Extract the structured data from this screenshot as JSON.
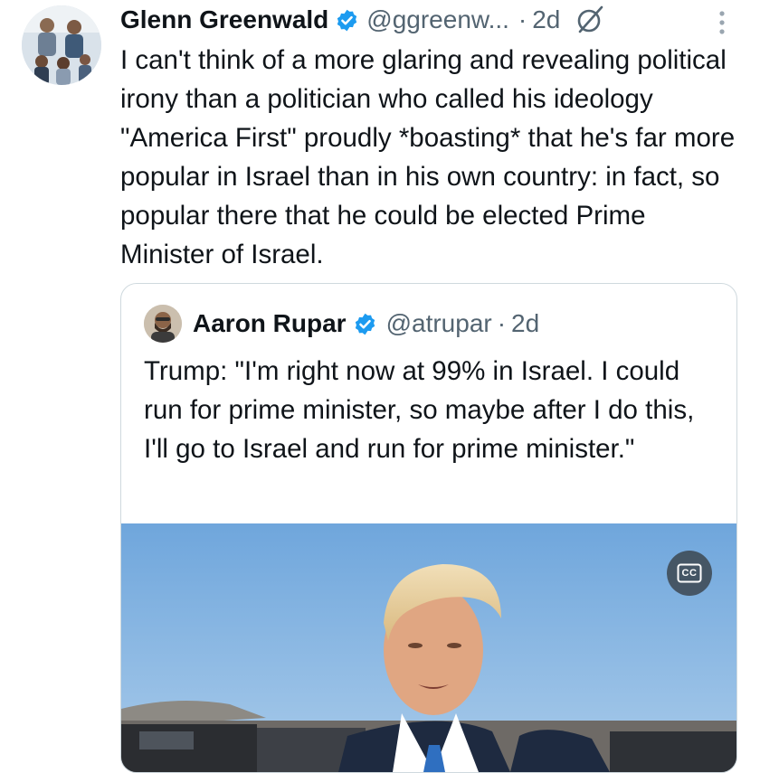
{
  "tweet": {
    "author_name": "Glenn Greenwald",
    "handle": "@ggreenw...",
    "separator": "·",
    "time": "2d",
    "text": "I can't think of a more glaring and revealing political irony than a politician who called his ideology \"America First\" proudly *boasting* that he's far more popular in Israel than in his own country: in fact, so popular there that he could be elected Prime Minister of Israel."
  },
  "quote": {
    "author_name": "Aaron Rupar",
    "handle": "@atrupar",
    "separator": "·",
    "time": "2d",
    "text": "Trump: \"I'm right now at 99% in Israel. I could run for prime minister, so maybe after I do this, I'll go to Israel and run for prime minister.\"",
    "cc_label": "CC"
  },
  "icons": {
    "verified": "verified-badge-icon",
    "grok": "grok-icon",
    "more": "more-vertical-icon",
    "captions": "closed-captions-icon"
  },
  "colors": {
    "verified_blue": "#1d9bf0",
    "text": "#0f1419",
    "secondary": "#536471",
    "border": "#cfd9de"
  }
}
